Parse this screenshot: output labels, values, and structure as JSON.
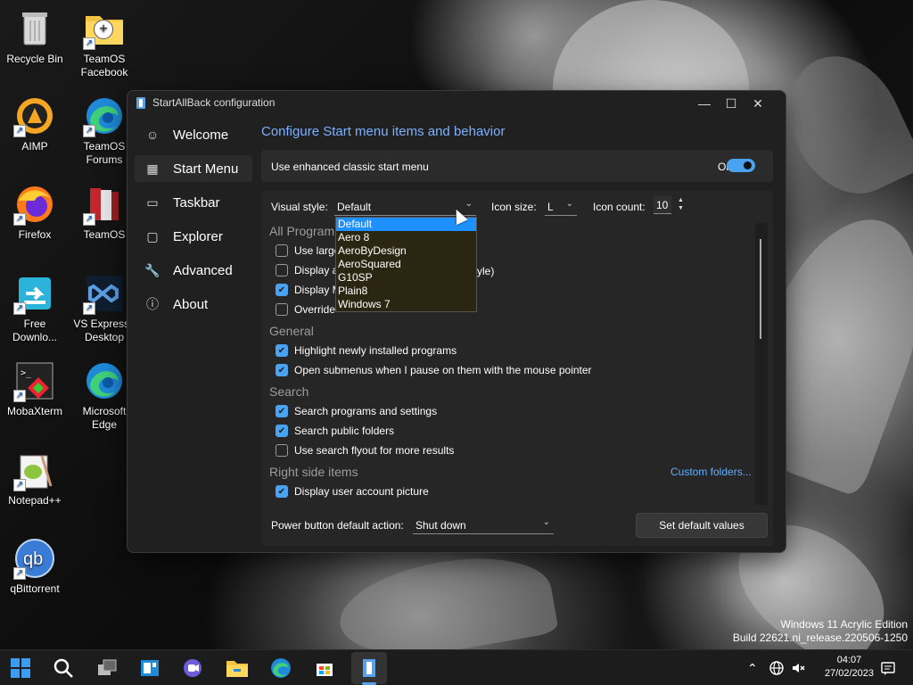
{
  "desktop": {
    "icons": [
      {
        "label": "Recycle Bin",
        "icon": "recycle-bin-icon"
      },
      {
        "label": "TeamOS\nFacebook",
        "icon": "folder-icon"
      },
      {
        "label": "AIMP",
        "icon": "aimp-icon"
      },
      {
        "label": "TeamOS\nForums",
        "icon": "edge-icon"
      },
      {
        "label": "Firefox",
        "icon": "firefox-icon"
      },
      {
        "label": "TeamOS",
        "icon": "winrar-icon"
      },
      {
        "label": "Free\nDownlo...",
        "icon": "free-download-icon"
      },
      {
        "label": "VS Express f\nDesktop",
        "icon": "visual-studio-icon"
      },
      {
        "label": "MobaXterm",
        "icon": "mobaxterm-icon"
      },
      {
        "label": "Microsoft\nEdge",
        "icon": "edge-icon"
      },
      {
        "label": "Notepad++",
        "icon": "notepadpp-icon"
      },
      {
        "label": "qBittorrent",
        "icon": "qbittorrent-icon"
      }
    ]
  },
  "window": {
    "title": "StartAllBack configuration",
    "controls": {
      "minimize": "—",
      "maximize": "☐",
      "close": "✕"
    },
    "nav": [
      {
        "label": "Welcome",
        "icon": "smiley-icon",
        "glyph": "☺"
      },
      {
        "label": "Start Menu",
        "icon": "start-menu-icon",
        "glyph": "▦"
      },
      {
        "label": "Taskbar",
        "icon": "taskbar-icon",
        "glyph": "▭"
      },
      {
        "label": "Explorer",
        "icon": "explorer-icon",
        "glyph": "▢"
      },
      {
        "label": "Advanced",
        "icon": "wrench-icon",
        "glyph": "🔧"
      },
      {
        "label": "About",
        "icon": "info-icon",
        "glyph": "ⓘ"
      }
    ],
    "active_nav": "Start Menu",
    "page_title": "Configure Start menu items and behavior",
    "enhanced": {
      "label": "Use enhanced classic start menu",
      "state": "On"
    },
    "visual_style": {
      "label": "Visual style:",
      "value": "Default"
    },
    "icon_size": {
      "label": "Icon size:",
      "value": "L"
    },
    "icon_count": {
      "label": "Icon count:",
      "value": "10"
    },
    "dropdown_options": [
      "Default",
      "Aero 8",
      "AeroByDesign",
      "AeroSquared",
      "G10SP",
      "Plain8",
      "Windows 7"
    ],
    "sections": {
      "all_programs": "All Program",
      "general": "General",
      "search": "Search",
      "right_side": "Right side items"
    },
    "all_programs_items": [
      {
        "label": "Use large",
        "checked": false
      },
      {
        "label": "Display a",
        "suffix": "yle)",
        "checked": false
      },
      {
        "label": "Display M",
        "checked": true
      },
      {
        "label": "Override ",
        "checked": false
      }
    ],
    "general_items": [
      {
        "label": "Highlight newly installed programs",
        "checked": true
      },
      {
        "label": "Open submenus when I pause on them with the mouse pointer",
        "checked": true
      }
    ],
    "search_items": [
      {
        "label": "Search programs and settings",
        "checked": true
      },
      {
        "label": "Search public folders",
        "checked": true
      },
      {
        "label": "Use search flyout for more results",
        "checked": false
      }
    ],
    "custom_folders": "Custom folders...",
    "right_side_items": [
      {
        "label": "Display user account picture",
        "checked": true
      }
    ],
    "power_button": {
      "label": "Power button default action:",
      "value": "Shut down"
    },
    "set_default": "Set default values"
  },
  "watermark": {
    "line1": "Windows 11 Acrylic Edition",
    "line2": "Build 22621.ni_release.220506-1250"
  },
  "taskbar": {
    "apps": [
      "start-icon",
      "search-icon",
      "task-view-icon",
      "widgets-icon",
      "teams-chat-icon",
      "file-explorer-icon",
      "edge-icon",
      "store-icon",
      "startallback-icon"
    ],
    "clock": {
      "time": "04:07",
      "date": "27/02/2023"
    }
  },
  "colors": {
    "accent": "#4aa3f0",
    "title_blue": "#7cb0ff",
    "link": "#5fb0ff"
  }
}
